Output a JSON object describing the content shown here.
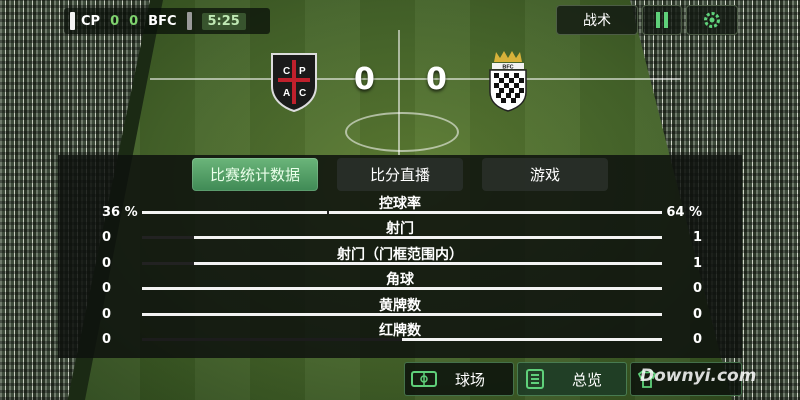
{
  "scoreboard": {
    "home": "CP",
    "home_goals": "0",
    "away_goals": "0",
    "away": "BFC",
    "time": "5:25"
  },
  "top_buttons": {
    "tactics": "战术"
  },
  "match": {
    "home_crest_letters": [
      "C",
      "P",
      "A",
      "C"
    ],
    "home_score": "0",
    "away_score": "0",
    "away_crest_text": "BFC"
  },
  "tabs": [
    {
      "label": "比赛统计数据",
      "active": true
    },
    {
      "label": "比分直播",
      "active": false
    },
    {
      "label": "游戏",
      "active": false
    }
  ],
  "stats": [
    {
      "label": "控球率",
      "left": "36 %",
      "right": "64 %",
      "left_share": 0.36,
      "right_share": 0.64
    },
    {
      "label": "射门",
      "left": "0",
      "right": "1",
      "left_share": 0,
      "right_share": 1
    },
    {
      "label": "射门（门框范围内）",
      "left": "0",
      "right": "1",
      "left_share": 0,
      "right_share": 1
    },
    {
      "label": "角球",
      "left": "0",
      "right": "0",
      "left_share": 0,
      "right_share": 0
    },
    {
      "label": "黄牌数",
      "left": "0",
      "right": "0",
      "left_share": 0,
      "right_share": 0
    },
    {
      "label": "红牌数",
      "left": "0",
      "right": "0",
      "left_share": 0,
      "right_share": 0
    }
  ],
  "bottom_buttons": {
    "pitch": "球场",
    "overview": "总览"
  },
  "watermark": "Downyi.com",
  "colors": {
    "accent_green": "#4ea563",
    "score_green": "#7fd36e",
    "crest_red": "#b0202a"
  }
}
